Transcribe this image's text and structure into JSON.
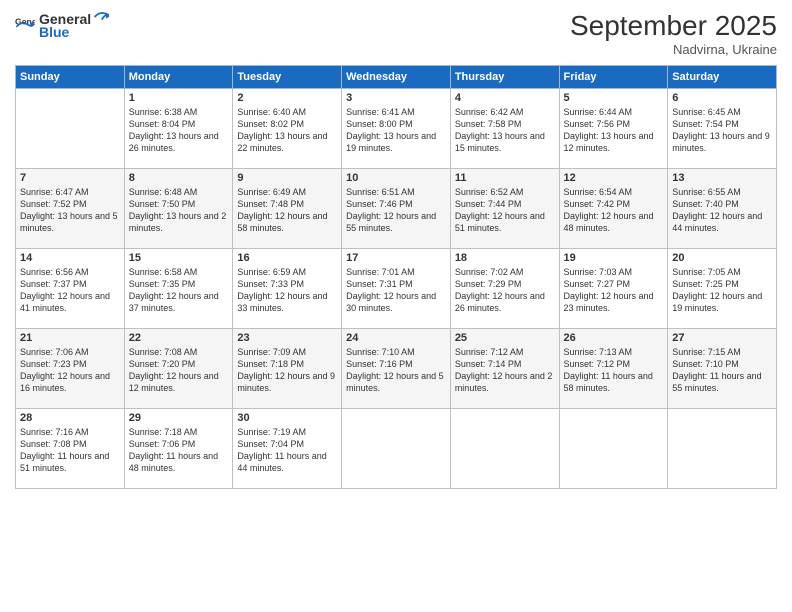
{
  "logo": {
    "general": "General",
    "blue": "Blue"
  },
  "title": "September 2025",
  "location": "Nadvirna, Ukraine",
  "days_of_week": [
    "Sunday",
    "Monday",
    "Tuesday",
    "Wednesday",
    "Thursday",
    "Friday",
    "Saturday"
  ],
  "weeks": [
    [
      {
        "day": "",
        "sunrise": "",
        "sunset": "",
        "daylight": ""
      },
      {
        "day": "1",
        "sunrise": "Sunrise: 6:38 AM",
        "sunset": "Sunset: 8:04 PM",
        "daylight": "Daylight: 13 hours and 26 minutes."
      },
      {
        "day": "2",
        "sunrise": "Sunrise: 6:40 AM",
        "sunset": "Sunset: 8:02 PM",
        "daylight": "Daylight: 13 hours and 22 minutes."
      },
      {
        "day": "3",
        "sunrise": "Sunrise: 6:41 AM",
        "sunset": "Sunset: 8:00 PM",
        "daylight": "Daylight: 13 hours and 19 minutes."
      },
      {
        "day": "4",
        "sunrise": "Sunrise: 6:42 AM",
        "sunset": "Sunset: 7:58 PM",
        "daylight": "Daylight: 13 hours and 15 minutes."
      },
      {
        "day": "5",
        "sunrise": "Sunrise: 6:44 AM",
        "sunset": "Sunset: 7:56 PM",
        "daylight": "Daylight: 13 hours and 12 minutes."
      },
      {
        "day": "6",
        "sunrise": "Sunrise: 6:45 AM",
        "sunset": "Sunset: 7:54 PM",
        "daylight": "Daylight: 13 hours and 9 minutes."
      }
    ],
    [
      {
        "day": "7",
        "sunrise": "Sunrise: 6:47 AM",
        "sunset": "Sunset: 7:52 PM",
        "daylight": "Daylight: 13 hours and 5 minutes."
      },
      {
        "day": "8",
        "sunrise": "Sunrise: 6:48 AM",
        "sunset": "Sunset: 7:50 PM",
        "daylight": "Daylight: 13 hours and 2 minutes."
      },
      {
        "day": "9",
        "sunrise": "Sunrise: 6:49 AM",
        "sunset": "Sunset: 7:48 PM",
        "daylight": "Daylight: 12 hours and 58 minutes."
      },
      {
        "day": "10",
        "sunrise": "Sunrise: 6:51 AM",
        "sunset": "Sunset: 7:46 PM",
        "daylight": "Daylight: 12 hours and 55 minutes."
      },
      {
        "day": "11",
        "sunrise": "Sunrise: 6:52 AM",
        "sunset": "Sunset: 7:44 PM",
        "daylight": "Daylight: 12 hours and 51 minutes."
      },
      {
        "day": "12",
        "sunrise": "Sunrise: 6:54 AM",
        "sunset": "Sunset: 7:42 PM",
        "daylight": "Daylight: 12 hours and 48 minutes."
      },
      {
        "day": "13",
        "sunrise": "Sunrise: 6:55 AM",
        "sunset": "Sunset: 7:40 PM",
        "daylight": "Daylight: 12 hours and 44 minutes."
      }
    ],
    [
      {
        "day": "14",
        "sunrise": "Sunrise: 6:56 AM",
        "sunset": "Sunset: 7:37 PM",
        "daylight": "Daylight: 12 hours and 41 minutes."
      },
      {
        "day": "15",
        "sunrise": "Sunrise: 6:58 AM",
        "sunset": "Sunset: 7:35 PM",
        "daylight": "Daylight: 12 hours and 37 minutes."
      },
      {
        "day": "16",
        "sunrise": "Sunrise: 6:59 AM",
        "sunset": "Sunset: 7:33 PM",
        "daylight": "Daylight: 12 hours and 33 minutes."
      },
      {
        "day": "17",
        "sunrise": "Sunrise: 7:01 AM",
        "sunset": "Sunset: 7:31 PM",
        "daylight": "Daylight: 12 hours and 30 minutes."
      },
      {
        "day": "18",
        "sunrise": "Sunrise: 7:02 AM",
        "sunset": "Sunset: 7:29 PM",
        "daylight": "Daylight: 12 hours and 26 minutes."
      },
      {
        "day": "19",
        "sunrise": "Sunrise: 7:03 AM",
        "sunset": "Sunset: 7:27 PM",
        "daylight": "Daylight: 12 hours and 23 minutes."
      },
      {
        "day": "20",
        "sunrise": "Sunrise: 7:05 AM",
        "sunset": "Sunset: 7:25 PM",
        "daylight": "Daylight: 12 hours and 19 minutes."
      }
    ],
    [
      {
        "day": "21",
        "sunrise": "Sunrise: 7:06 AM",
        "sunset": "Sunset: 7:23 PM",
        "daylight": "Daylight: 12 hours and 16 minutes."
      },
      {
        "day": "22",
        "sunrise": "Sunrise: 7:08 AM",
        "sunset": "Sunset: 7:20 PM",
        "daylight": "Daylight: 12 hours and 12 minutes."
      },
      {
        "day": "23",
        "sunrise": "Sunrise: 7:09 AM",
        "sunset": "Sunset: 7:18 PM",
        "daylight": "Daylight: 12 hours and 9 minutes."
      },
      {
        "day": "24",
        "sunrise": "Sunrise: 7:10 AM",
        "sunset": "Sunset: 7:16 PM",
        "daylight": "Daylight: 12 hours and 5 minutes."
      },
      {
        "day": "25",
        "sunrise": "Sunrise: 7:12 AM",
        "sunset": "Sunset: 7:14 PM",
        "daylight": "Daylight: 12 hours and 2 minutes."
      },
      {
        "day": "26",
        "sunrise": "Sunrise: 7:13 AM",
        "sunset": "Sunset: 7:12 PM",
        "daylight": "Daylight: 11 hours and 58 minutes."
      },
      {
        "day": "27",
        "sunrise": "Sunrise: 7:15 AM",
        "sunset": "Sunset: 7:10 PM",
        "daylight": "Daylight: 11 hours and 55 minutes."
      }
    ],
    [
      {
        "day": "28",
        "sunrise": "Sunrise: 7:16 AM",
        "sunset": "Sunset: 7:08 PM",
        "daylight": "Daylight: 11 hours and 51 minutes."
      },
      {
        "day": "29",
        "sunrise": "Sunrise: 7:18 AM",
        "sunset": "Sunset: 7:06 PM",
        "daylight": "Daylight: 11 hours and 48 minutes."
      },
      {
        "day": "30",
        "sunrise": "Sunrise: 7:19 AM",
        "sunset": "Sunset: 7:04 PM",
        "daylight": "Daylight: 11 hours and 44 minutes."
      },
      {
        "day": "",
        "sunrise": "",
        "sunset": "",
        "daylight": ""
      },
      {
        "day": "",
        "sunrise": "",
        "sunset": "",
        "daylight": ""
      },
      {
        "day": "",
        "sunrise": "",
        "sunset": "",
        "daylight": ""
      },
      {
        "day": "",
        "sunrise": "",
        "sunset": "",
        "daylight": ""
      }
    ]
  ]
}
